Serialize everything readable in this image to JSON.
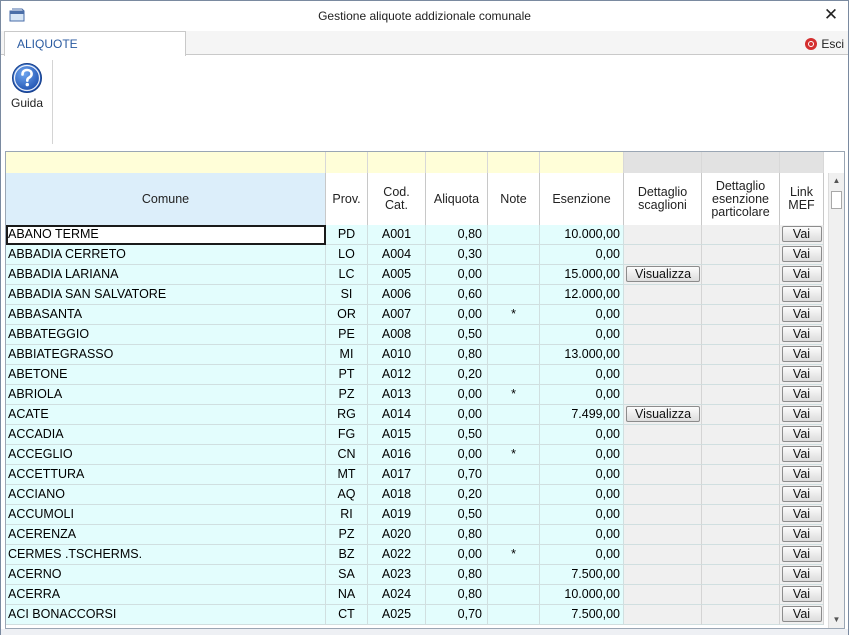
{
  "window": {
    "title": "Gestione aliquote addizionale comunale",
    "close_glyph": "✕"
  },
  "tabs": [
    {
      "label": "ALIQUOTE",
      "active": true
    }
  ],
  "esci_label": "Esci",
  "ribbon": {
    "guida_label": "Guida"
  },
  "grid": {
    "columns": [
      {
        "key": "comune",
        "label": "Comune"
      },
      {
        "key": "prov",
        "label": "Prov."
      },
      {
        "key": "cod",
        "label": "Cod.\nCat."
      },
      {
        "key": "aliquota",
        "label": "Aliquota"
      },
      {
        "key": "note",
        "label": "Note"
      },
      {
        "key": "esenzione",
        "label": "Esenzione"
      },
      {
        "key": "dettaglio",
        "label": "Dettaglio\nscaglioni"
      },
      {
        "key": "particolare",
        "label": "Dettaglio\nesenzione\nparticolare"
      },
      {
        "key": "link",
        "label": "Link\nMEF"
      }
    ],
    "button_vai": "Vai",
    "button_visualizza": "Visualizza",
    "rows": [
      {
        "comune": "ABANO TERME",
        "prov": "PD",
        "cod": "A001",
        "aliquota": "0,80",
        "note": "",
        "esenzione": "10.000,00",
        "dettaglio": false
      },
      {
        "comune": "ABBADIA CERRETO",
        "prov": "LO",
        "cod": "A004",
        "aliquota": "0,30",
        "note": "",
        "esenzione": "0,00",
        "dettaglio": false
      },
      {
        "comune": "ABBADIA LARIANA",
        "prov": "LC",
        "cod": "A005",
        "aliquota": "0,00",
        "note": "",
        "esenzione": "15.000,00",
        "dettaglio": true
      },
      {
        "comune": "ABBADIA SAN SALVATORE",
        "prov": "SI",
        "cod": "A006",
        "aliquota": "0,60",
        "note": "",
        "esenzione": "12.000,00",
        "dettaglio": false
      },
      {
        "comune": "ABBASANTA",
        "prov": "OR",
        "cod": "A007",
        "aliquota": "0,00",
        "note": "*",
        "esenzione": "0,00",
        "dettaglio": false
      },
      {
        "comune": "ABBATEGGIO",
        "prov": "PE",
        "cod": "A008",
        "aliquota": "0,50",
        "note": "",
        "esenzione": "0,00",
        "dettaglio": false
      },
      {
        "comune": "ABBIATEGRASSO",
        "prov": "MI",
        "cod": "A010",
        "aliquota": "0,80",
        "note": "",
        "esenzione": "13.000,00",
        "dettaglio": false
      },
      {
        "comune": "ABETONE",
        "prov": "PT",
        "cod": "A012",
        "aliquota": "0,20",
        "note": "",
        "esenzione": "0,00",
        "dettaglio": false
      },
      {
        "comune": "ABRIOLA",
        "prov": "PZ",
        "cod": "A013",
        "aliquota": "0,00",
        "note": "*",
        "esenzione": "0,00",
        "dettaglio": false
      },
      {
        "comune": "ACATE",
        "prov": "RG",
        "cod": "A014",
        "aliquota": "0,00",
        "note": "",
        "esenzione": "7.499,00",
        "dettaglio": true
      },
      {
        "comune": "ACCADIA",
        "prov": "FG",
        "cod": "A015",
        "aliquota": "0,50",
        "note": "",
        "esenzione": "0,00",
        "dettaglio": false
      },
      {
        "comune": "ACCEGLIO",
        "prov": "CN",
        "cod": "A016",
        "aliquota": "0,00",
        "note": "*",
        "esenzione": "0,00",
        "dettaglio": false
      },
      {
        "comune": "ACCETTURA",
        "prov": "MT",
        "cod": "A017",
        "aliquota": "0,70",
        "note": "",
        "esenzione": "0,00",
        "dettaglio": false
      },
      {
        "comune": "ACCIANO",
        "prov": "AQ",
        "cod": "A018",
        "aliquota": "0,20",
        "note": "",
        "esenzione": "0,00",
        "dettaglio": false
      },
      {
        "comune": "ACCUMOLI",
        "prov": "RI",
        "cod": "A019",
        "aliquota": "0,50",
        "note": "",
        "esenzione": "0,00",
        "dettaglio": false
      },
      {
        "comune": "ACERENZA",
        "prov": "PZ",
        "cod": "A020",
        "aliquota": "0,80",
        "note": "",
        "esenzione": "0,00",
        "dettaglio": false
      },
      {
        "comune": "CERMES .TSCHERMS.",
        "prov": "BZ",
        "cod": "A022",
        "aliquota": "0,00",
        "note": "*",
        "esenzione": "0,00",
        "dettaglio": false
      },
      {
        "comune": "ACERNO",
        "prov": "SA",
        "cod": "A023",
        "aliquota": "0,80",
        "note": "",
        "esenzione": "7.500,00",
        "dettaglio": false
      },
      {
        "comune": "ACERRA",
        "prov": "NA",
        "cod": "A024",
        "aliquota": "0,80",
        "note": "",
        "esenzione": "10.000,00",
        "dettaglio": false
      },
      {
        "comune": "ACI BONACCORSI",
        "prov": "CT",
        "cod": "A025",
        "aliquota": "0,70",
        "note": "",
        "esenzione": "7.500,00",
        "dettaglio": false
      }
    ]
  },
  "colors": {
    "filter_row": "#fffed8",
    "filter_row_disabled": "#e2e2e2",
    "comune_header": "#dceefa",
    "row_background": "#e3fdfd",
    "disabled_cell": "#f0f0f0",
    "tab_text": "#2a5aa0",
    "esci_icon": "#d42f2f",
    "guida_icon": "#2a63c8"
  },
  "icons": {
    "app": "app-window-icon",
    "guida": "help-question-icon",
    "esci": "exit-icon",
    "close": "close-icon"
  }
}
